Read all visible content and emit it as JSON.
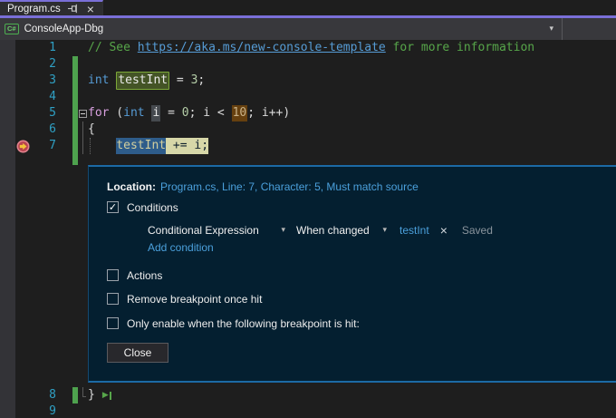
{
  "tab": {
    "title": "Program.cs",
    "close_icon": "×"
  },
  "toolbar": {
    "badge": "C#",
    "project": "ConsoleApp-Dbg",
    "caret": "▾"
  },
  "colors": {
    "accent_purple": "#7A6FD8",
    "dialog_border_blue": "#1C6AA5",
    "dialog_background": "#041F30",
    "changed_lines_green": "#4EA24E",
    "breakpoint_red": "#B8434E",
    "breakpoint_arrow_yellow": "#F3C33A",
    "link_blue": "#4BA0DC",
    "statement_highlight_yellow": "#D7D7A8",
    "selection_blue": "#2E5C8A"
  },
  "editor": {
    "lines": [
      {
        "n": "1",
        "tokens": [
          {
            "t": "// See ",
            "c": "com"
          },
          {
            "t": "https://aka.ms/new-console-template",
            "c": "url"
          },
          {
            "t": " for more information",
            "c": "com"
          }
        ]
      },
      {
        "n": "2",
        "bar": true,
        "tokens": []
      },
      {
        "n": "3",
        "bar": true,
        "tokens": [
          {
            "t": "int",
            "c": "kw"
          },
          {
            "t": " ",
            "c": "pl"
          },
          {
            "t": "testInt",
            "c": "defhl"
          },
          {
            "t": " = ",
            "c": "pl"
          },
          {
            "t": "3",
            "c": "num"
          },
          {
            "t": ";",
            "c": "pl"
          }
        ]
      },
      {
        "n": "4",
        "bar": true,
        "tokens": []
      },
      {
        "n": "5",
        "bar": true,
        "fold": "collapse",
        "tokens": [
          {
            "t": "for",
            "c": "ctrl"
          },
          {
            "t": " (",
            "c": "pl"
          },
          {
            "t": "int",
            "c": "kw"
          },
          {
            "t": " ",
            "c": "pl"
          },
          {
            "t": "i",
            "c": "refhl"
          },
          {
            "t": " = ",
            "c": "pl"
          },
          {
            "t": "0",
            "c": "num"
          },
          {
            "t": "; i < ",
            "c": "pl"
          },
          {
            "t": "10",
            "c": "numhl"
          },
          {
            "t": "; i++)",
            "c": "pl"
          }
        ]
      },
      {
        "n": "6",
        "bar": true,
        "guide": true,
        "tokens": [
          {
            "t": "{",
            "c": "pl"
          }
        ]
      },
      {
        "n": "7",
        "bar": true,
        "guide": true,
        "bp": true,
        "dotted": true,
        "tokens": [
          {
            "t": "    ",
            "c": "pl"
          },
          {
            "t": "testInt",
            "c": "selblue"
          },
          {
            "t": " += i;",
            "c": "stmtyellow"
          }
        ]
      },
      {
        "spacer": true,
        "bar": true
      },
      {
        "n": "8",
        "below": true,
        "bar": true,
        "guide": "end",
        "run": true,
        "tokens": [
          {
            "t": "}",
            "c": "pl"
          }
        ]
      },
      {
        "n": "9",
        "below": true,
        "tokens": []
      }
    ]
  },
  "dialog": {
    "location_label": "Location:",
    "location_value": "Program.cs, Line: 7, Character: 5, Must match source",
    "conditions_label": "Conditions",
    "condition_type": "Conditional Expression",
    "condition_mode": "When changed",
    "condition_expression": "testInt",
    "remove_condition_icon": "×",
    "saved_label": "Saved",
    "add_condition_label": "Add condition",
    "actions_label": "Actions",
    "remove_once_label": "Remove breakpoint once hit",
    "only_enable_label": "Only enable when the following breakpoint is hit:",
    "close_label": "Close",
    "checkmark": "✓",
    "caret": "▾"
  }
}
